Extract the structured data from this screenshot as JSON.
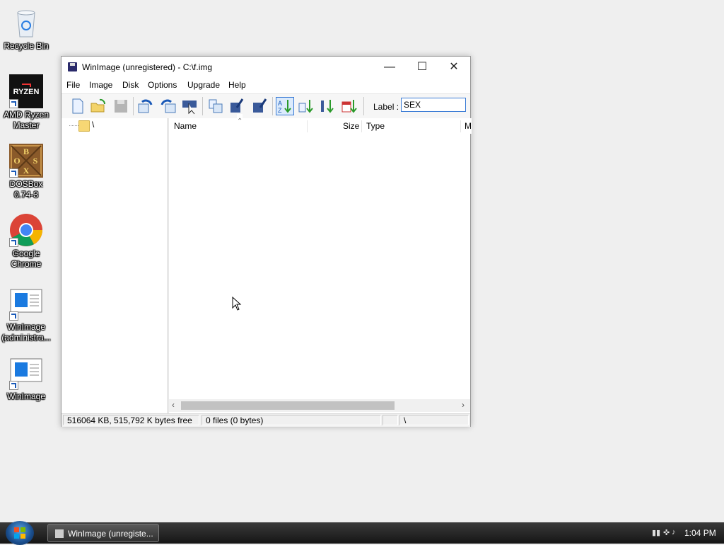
{
  "desktop": {
    "icons": [
      {
        "label": "Recycle Bin"
      },
      {
        "label": "AMD Ryzen Master"
      },
      {
        "label": "DOSBox 0.74-3"
      },
      {
        "label": "Google Chrome"
      },
      {
        "label": "WinImage (administra..."
      },
      {
        "label": "WinImage"
      }
    ],
    "ryzen_logo": "RYZEN",
    "dosbox_letters": "BOSX"
  },
  "window": {
    "title": "WinImage (unregistered) - C:\\f.img",
    "menu": [
      "File",
      "Image",
      "Disk",
      "Options",
      "Upgrade",
      "Help"
    ],
    "toolbar": {
      "label_text": "Label :",
      "label_value": "SEX"
    },
    "tree": {
      "root": "\\"
    },
    "columns": [
      "Name",
      "Size",
      "Type",
      "M"
    ],
    "status": {
      "disk": "516064 KB, 515,792 K bytes free",
      "files": "0 files (0 bytes)",
      "path": "\\"
    }
  },
  "taskbar": {
    "task_label": "WinImage (unregiste...",
    "clock": "1:04 PM"
  },
  "colors": {
    "accent": "#3a7bd5",
    "taskbar": "#1e1e1e"
  }
}
